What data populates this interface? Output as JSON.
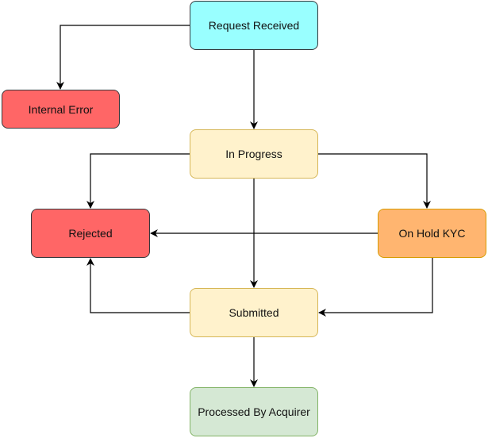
{
  "nodes": {
    "request_received": {
      "label": "Request Received",
      "fill": "#99FFFF",
      "stroke": "#36393D"
    },
    "internal_error": {
      "label": "Internal Error",
      "fill": "#FF6666",
      "stroke": "#36393D"
    },
    "in_progress": {
      "label": "In Progress",
      "fill": "#FFF2CC",
      "stroke": "#D6B656"
    },
    "rejected": {
      "label": "Rejected",
      "fill": "#FF6666",
      "stroke": "#36393D"
    },
    "on_hold_kyc": {
      "label": "On Hold KYC",
      "fill": "#FFB570",
      "stroke": "#D79B00"
    },
    "submitted": {
      "label": "Submitted",
      "fill": "#FFF2CC",
      "stroke": "#D6B656"
    },
    "processed": {
      "label": "Processed By Acquirer",
      "fill": "#D5E8D4",
      "stroke": "#82B366"
    }
  },
  "edges": [
    {
      "from": "Request Received",
      "to": "Internal Error"
    },
    {
      "from": "Request Received",
      "to": "In Progress"
    },
    {
      "from": "In Progress",
      "to": "Rejected"
    },
    {
      "from": "In Progress",
      "to": "On Hold KYC"
    },
    {
      "from": "In Progress",
      "to": "Submitted"
    },
    {
      "from": "On Hold KYC",
      "to": "Rejected"
    },
    {
      "from": "On Hold KYC",
      "to": "Submitted"
    },
    {
      "from": "Submitted",
      "to": "Rejected"
    },
    {
      "from": "Submitted",
      "to": "Processed By Acquirer"
    }
  ]
}
